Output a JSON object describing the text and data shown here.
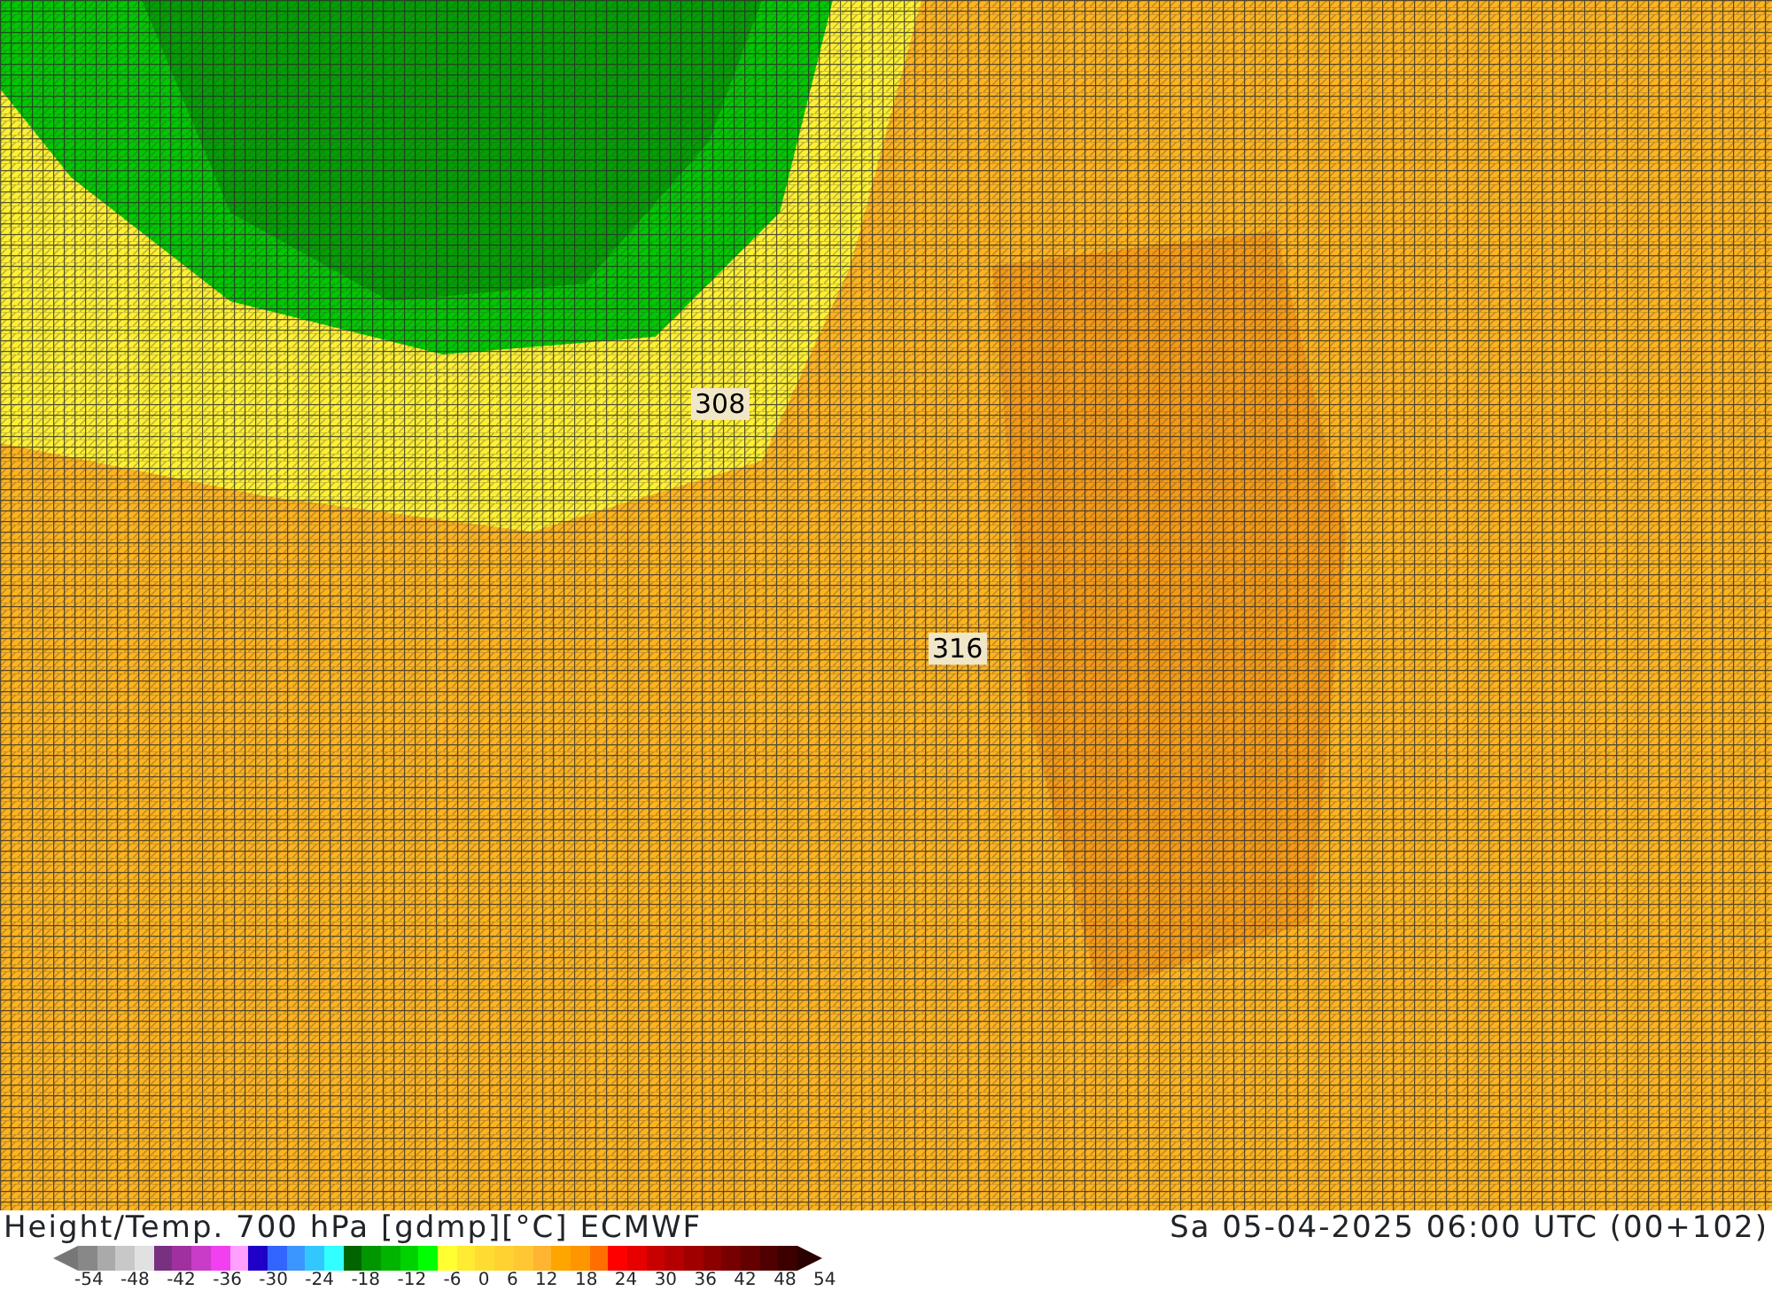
{
  "map": {
    "contour_labels": [
      {
        "text": "308"
      },
      {
        "text": "316"
      }
    ]
  },
  "footer": {
    "title": "Height/Temp. 700 hPa [gdmp][°C] ECMWF",
    "datetime": "Sa 05-04-2025 06:00 UTC (00+102)"
  },
  "legend": {
    "swatches": [
      {
        "color": "#888888"
      },
      {
        "color": "#aaaaaa"
      },
      {
        "color": "#c8c8c8"
      },
      {
        "color": "#e1e1e1"
      },
      {
        "color": "#7a3080"
      },
      {
        "color": "#a030a0"
      },
      {
        "color": "#c83cc8"
      },
      {
        "color": "#f040f0"
      },
      {
        "color": "#ffa0ff"
      },
      {
        "color": "#1e00c8"
      },
      {
        "color": "#3264ff"
      },
      {
        "color": "#3c96ff"
      },
      {
        "color": "#32c8ff"
      },
      {
        "color": "#32ffff"
      },
      {
        "color": "#006400"
      },
      {
        "color": "#009600"
      },
      {
        "color": "#00b400"
      },
      {
        "color": "#00d200"
      },
      {
        "color": "#00ff00"
      },
      {
        "color": "#ffff32"
      },
      {
        "color": "#ffeb32"
      },
      {
        "color": "#ffdc32"
      },
      {
        "color": "#ffd232"
      },
      {
        "color": "#ffc832"
      },
      {
        "color": "#ffb432"
      },
      {
        "color": "#ffa500"
      },
      {
        "color": "#ff9600"
      },
      {
        "color": "#ff6e00"
      },
      {
        "color": "#ff0000"
      },
      {
        "color": "#e60000"
      },
      {
        "color": "#c80000"
      },
      {
        "color": "#b40000"
      },
      {
        "color": "#a00000"
      },
      {
        "color": "#8c0000"
      },
      {
        "color": "#780000"
      },
      {
        "color": "#640000"
      },
      {
        "color": "#500000"
      },
      {
        "color": "#3c0000"
      }
    ],
    "ticks": [
      "-54",
      "-48",
      "-42",
      "-36",
      "-30",
      "-24",
      "-18",
      "-12",
      "-6",
      "0",
      "6",
      "12",
      "18",
      "24",
      "30",
      "36",
      "42",
      "48",
      "54"
    ]
  }
}
